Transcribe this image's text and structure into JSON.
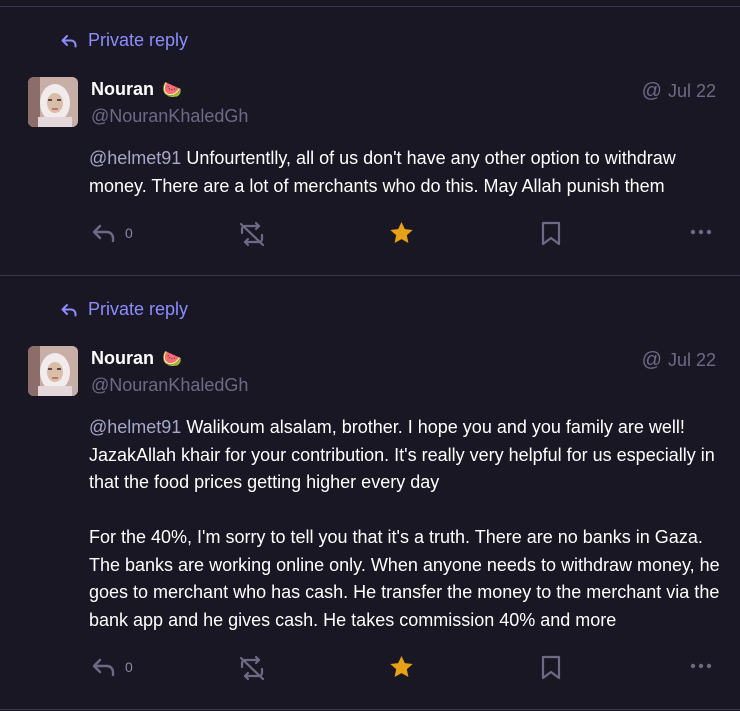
{
  "colors": {
    "background": "#191724",
    "divider": "#393552",
    "accent": "#8c8dff",
    "muted": "#6e6a86",
    "favourited": "#e6a117"
  },
  "statuses": [
    {
      "visibility_label": "Private reply",
      "author": {
        "display_name": "Nouran",
        "emoji": "🍉",
        "handle": "@NouranKhaledGh"
      },
      "date": "Jul 22",
      "mention": "@helmet91",
      "paragraphs": [
        "Unfourtentlly, all of us don't have any other option to withdraw money. There are a lot of merchants who do this. May Allah punish them"
      ],
      "reply_count": "0",
      "favourited": true,
      "icons": [
        "reply-icon",
        "boost-icon",
        "star-icon",
        "bookmark-icon",
        "more-icon"
      ]
    },
    {
      "visibility_label": "Private reply",
      "author": {
        "display_name": "Nouran",
        "emoji": "🍉",
        "handle": "@NouranKhaledGh"
      },
      "date": "Jul 22",
      "mention": "@helmet91",
      "paragraphs": [
        "Walikoum alsalam, brother. I hope you and you family are well! JazakAllah khair for your contribution. It's really very helpful for us especially in that the food prices getting higher every day",
        "For the 40%, I'm sorry to tell you that it's a truth. There are no banks in Gaza. The banks are working online only. When anyone needs to withdraw money, he goes to merchant who has cash. He transfer the money to the merchant via the bank app and he gives cash. He takes commission 40% and more"
      ],
      "reply_count": "0",
      "favourited": true,
      "icons": [
        "reply-icon",
        "boost-icon",
        "star-icon",
        "bookmark-icon",
        "more-icon"
      ]
    }
  ]
}
